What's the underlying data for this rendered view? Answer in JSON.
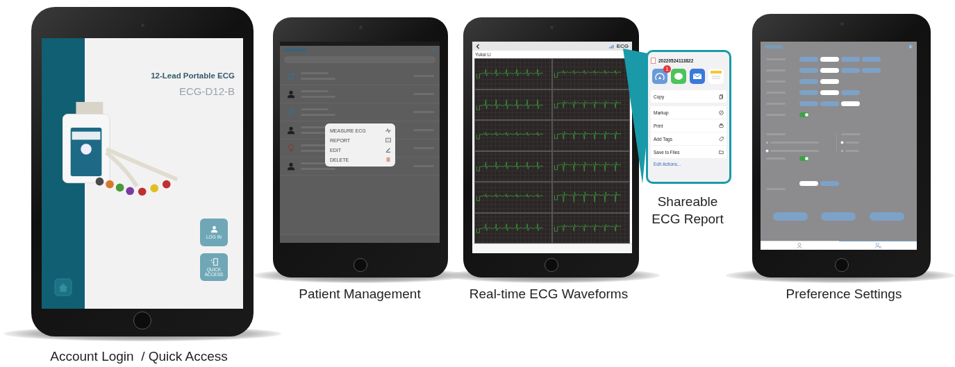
{
  "login_screen": {
    "title": "12-Lead Portable ECG",
    "model": "ECG-D12-B",
    "buttons": [
      {
        "kind": "login",
        "label": "LOG IN"
      },
      {
        "kind": "quick",
        "label": "QUICK ACCESS"
      }
    ],
    "caption": "Account Login  / Quick Access"
  },
  "patients_screen": {
    "patients": [
      {
        "kind": "male"
      },
      {
        "kind": "person"
      },
      {
        "kind": "male"
      },
      {
        "kind": "person"
      },
      {
        "kind": "female"
      },
      {
        "kind": "person"
      }
    ],
    "menu": [
      {
        "kind": "measure",
        "label": "MEASURE ECG"
      },
      {
        "kind": "report",
        "label": "REPORT"
      },
      {
        "kind": "edit",
        "label": "EDIT"
      },
      {
        "kind": "delete",
        "label": "DELETE"
      }
    ],
    "caption": "Patient Management"
  },
  "ecg_screen": {
    "title": "ECG",
    "patient": "Yukai Li",
    "caption": "Real-time ECG Waveforms"
  },
  "share_sheet": {
    "file": "20220524113822",
    "apps": [
      {
        "kind": "airdrop",
        "badge": "1"
      },
      {
        "kind": "messages"
      },
      {
        "kind": "mail"
      },
      {
        "kind": "notes"
      }
    ],
    "actions": [
      {
        "kind": "copy",
        "label": "Copy"
      },
      {
        "kind": "markup",
        "label": "Markup"
      },
      {
        "kind": "print",
        "label": "Print"
      },
      {
        "kind": "tags",
        "label": "Add Tags"
      },
      {
        "kind": "files",
        "label": "Save to Files"
      }
    ],
    "edit_link": "Edit Actions...",
    "caption": [
      "Shareable",
      "ECG Report"
    ]
  },
  "settings_screen": {
    "rows": [
      {
        "kind": "segments",
        "options": [
          {
            "selected": false
          },
          {
            "selected": true
          },
          {
            "selected": false
          },
          {
            "selected": false
          }
        ]
      },
      {
        "kind": "segments",
        "options": [
          {
            "selected": false
          },
          {
            "selected": true
          },
          {
            "selected": false
          },
          {
            "selected": false
          }
        ]
      },
      {
        "kind": "segments",
        "options": [
          {
            "selected": false
          },
          {
            "selected": true
          }
        ]
      },
      {
        "kind": "segments",
        "options": [
          {
            "selected": false
          },
          {
            "selected": true
          },
          {
            "selected": false
          }
        ]
      },
      {
        "kind": "segments",
        "options": [
          {
            "selected": false
          },
          {
            "selected": false
          },
          {
            "selected": true
          }
        ]
      },
      {
        "kind": "toggle",
        "on": true
      }
    ],
    "radio_groups": [
      {
        "options": [
          {
            "selected": false
          },
          {
            "selected": true
          }
        ]
      },
      {
        "options": [
          {
            "selected": true
          },
          {
            "selected": false
          }
        ]
      }
    ],
    "show_report": {
      "on": true
    },
    "language": [
      {
        "selected": true
      },
      {
        "selected": false
      }
    ],
    "tabs": [
      {
        "kind": "patients",
        "selected": false
      },
      {
        "kind": "setting",
        "selected": true
      }
    ],
    "caption": "Preference Settings"
  }
}
